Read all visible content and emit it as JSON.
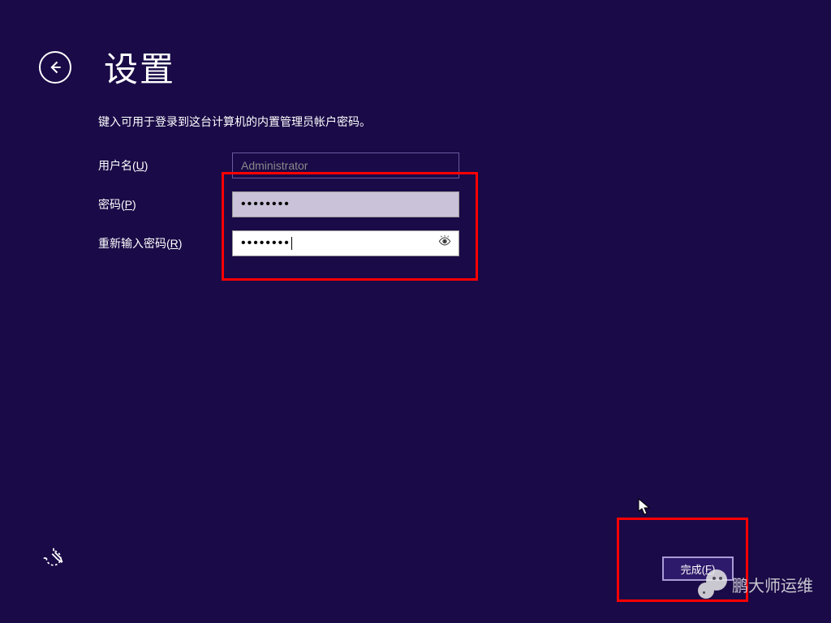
{
  "header": {
    "title": "设置"
  },
  "instruction": "键入可用于登录到这台计算机的内置管理员帐户密码。",
  "fields": {
    "username_label_pre": "用户名(",
    "username_hotkey": "U",
    "username_label_post": ")",
    "username_value": "Administrator",
    "password_label_pre": "密码(",
    "password_hotkey": "P",
    "password_label_post": ")",
    "password_mask": "••••••••",
    "confirm_label_pre": "重新输入密码(",
    "confirm_hotkey": "R",
    "confirm_label_post": ")",
    "confirm_mask": "••••••••"
  },
  "footer": {
    "finish_label_pre": "完成(",
    "finish_hotkey": "F",
    "finish_label_post": ")"
  },
  "watermark": "鹏大师运维"
}
